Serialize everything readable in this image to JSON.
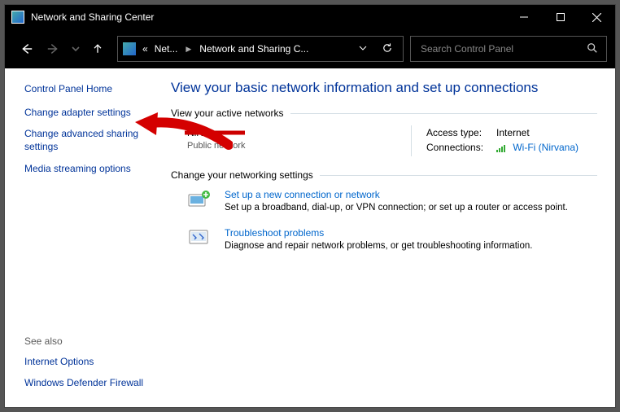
{
  "titlebar": {
    "title": "Network and Sharing Center"
  },
  "address": {
    "seg1": "Net...",
    "seg2": "Network and Sharing C...",
    "double_chevron": "«"
  },
  "search": {
    "placeholder": "Search Control Panel"
  },
  "sidebar": {
    "home": "Control Panel Home",
    "items": [
      "Change adapter settings",
      "Change advanced sharing settings",
      "Media streaming options"
    ],
    "seealso_label": "See also",
    "seealso": [
      "Internet Options",
      "Windows Defender Firewall"
    ]
  },
  "main": {
    "heading": "View your basic network information and set up connections",
    "active_header": "View your active networks",
    "network": {
      "name": "Nirvana",
      "type": "Public network",
      "access_label": "Access type:",
      "access_value": "Internet",
      "conn_label": "Connections:",
      "conn_value": "Wi-Fi (Nirvana)"
    },
    "change_header": "Change your networking settings",
    "options": [
      {
        "title": "Set up a new connection or network",
        "desc": "Set up a broadband, dial-up, or VPN connection; or set up a router or access point."
      },
      {
        "title": "Troubleshoot problems",
        "desc": "Diagnose and repair network problems, or get troubleshooting information."
      }
    ]
  }
}
